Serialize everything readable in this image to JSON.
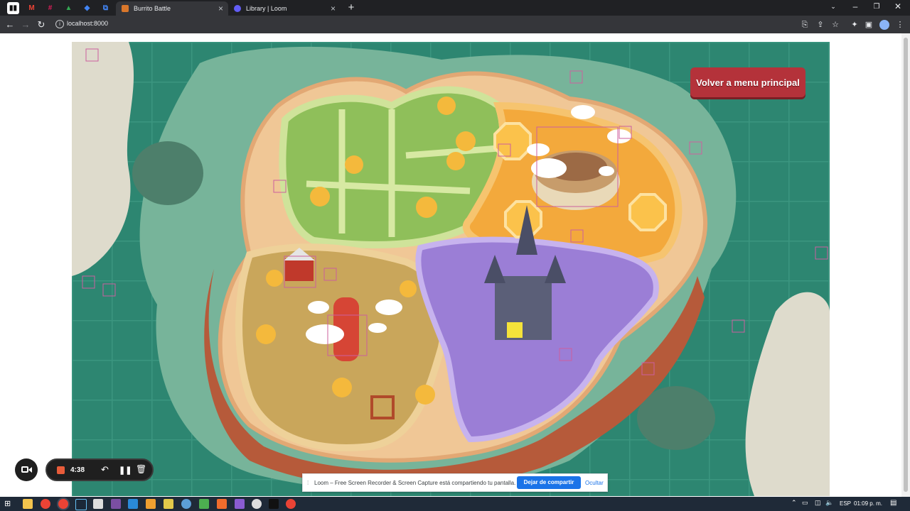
{
  "browser": {
    "tabs": [
      {
        "label": "Burrito Battle",
        "active": true
      },
      {
        "label": "Library | Loom",
        "active": false
      }
    ],
    "new_tab": "+",
    "address": "localhost:8000"
  },
  "game": {
    "menu_button": "Volver a menu principal",
    "zones": [
      "meadow",
      "colosseum",
      "farm",
      "haunted-castle"
    ]
  },
  "loom": {
    "timer": "4:38",
    "notice": "Loom – Free Screen Recorder & Screen Capture está compartiendo tu pantalla.",
    "stop_share": "Dejar de compartir",
    "hide": "Ocultar"
  },
  "taskbar": {
    "language": "ESP",
    "clock": "01:09 p. m."
  },
  "colors": {
    "sea": "#2f8a73",
    "accent_blue": "#1a73e8",
    "loom_red": "#e85c3a"
  }
}
